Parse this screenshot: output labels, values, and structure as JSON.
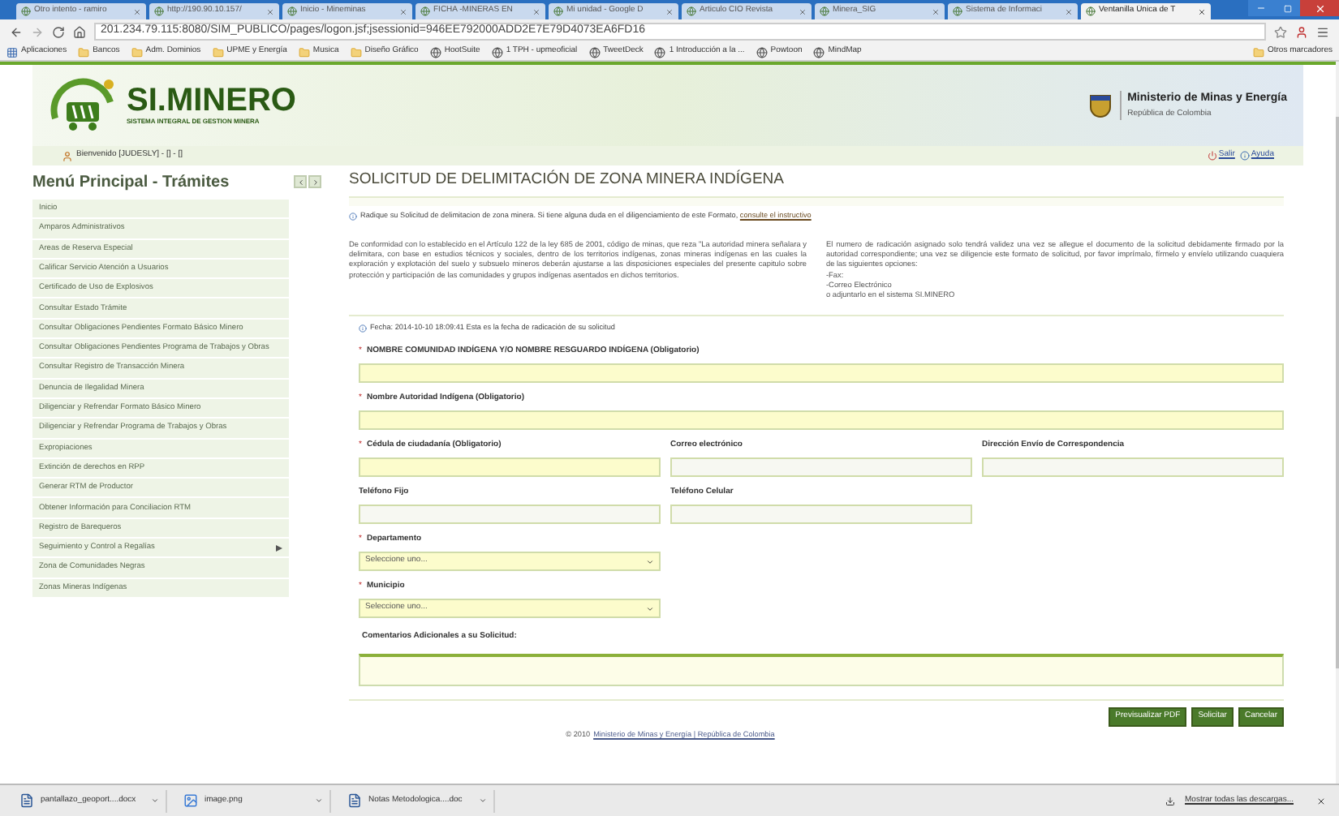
{
  "browser": {
    "tabs": [
      {
        "label": "Otro intento - ramiro",
        "selected": false
      },
      {
        "label": "http://190.90.10.157/",
        "selected": false
      },
      {
        "label": "Inicio - Mineminas",
        "selected": false
      },
      {
        "label": "FICHA -MINERAS EN",
        "selected": false
      },
      {
        "label": "Mi unidad - Google D",
        "selected": false
      },
      {
        "label": "Articulo CIO Revista",
        "selected": false
      },
      {
        "label": "Minera_SIG",
        "selected": false
      },
      {
        "label": "Sistema de Informaci",
        "selected": false
      },
      {
        "label": "Ventanilla Única de T",
        "selected": true
      }
    ],
    "address": "201.234.79.115:8080/SIM_PUBLICO/pages/logon.jsf;jsessionid=946EE792000ADD2E7E79D4073EA6FD16",
    "bookmarks": [
      {
        "label": "Aplicaciones",
        "kind": "apps"
      },
      {
        "label": "Bancos",
        "kind": "folder"
      },
      {
        "label": "Adm. Dominios",
        "kind": "folder"
      },
      {
        "label": "UPME y Energía",
        "kind": "folder"
      },
      {
        "label": "Musica",
        "kind": "folder"
      },
      {
        "label": "Diseño Gráfico",
        "kind": "folder"
      },
      {
        "label": "HootSuite",
        "kind": "site"
      },
      {
        "label": "1 TPH - upmeoficial",
        "kind": "site"
      },
      {
        "label": "TweetDeck",
        "kind": "site"
      },
      {
        "label": "1 Introducción a la ...",
        "kind": "site"
      },
      {
        "label": "Powtoon",
        "kind": "site"
      },
      {
        "label": "MindMap",
        "kind": "site"
      }
    ],
    "other_bookmarks": "Otros marcadores"
  },
  "header": {
    "logo_title": "SI.MINERO",
    "logo_subtitle": "SISTEMA INTEGRAL DE GESTION MINERA",
    "ministry": "Ministerio de Minas y Energía",
    "country": "República de Colombia"
  },
  "welcome": "Bienvenido [JUDESLY] - [] - []",
  "top_links": [
    "Salir",
    "Ayuda"
  ],
  "sidebar": {
    "title": "Menú Principal - Trámites",
    "items": [
      {
        "label": "Inicio",
        "has_submenu": false
      },
      {
        "label": "Amparos Administrativos",
        "has_submenu": false
      },
      {
        "label": "Areas de Reserva Especial",
        "has_submenu": false
      },
      {
        "label": "Calificar Servicio Atención a Usuarios",
        "has_submenu": false
      },
      {
        "label": "Certificado de Uso de Explosivos",
        "has_submenu": false
      },
      {
        "label": "Consultar Estado Trámite",
        "has_submenu": false
      },
      {
        "label": "Consultar Obligaciones Pendientes Formato Básico Minero",
        "has_submenu": false
      },
      {
        "label": "Consultar Obligaciones Pendientes Programa de Trabajos y Obras",
        "has_submenu": false
      },
      {
        "label": "Consultar Registro de Transacción Minera",
        "has_submenu": false
      },
      {
        "label": "Denuncia de Ilegalidad Minera",
        "has_submenu": false
      },
      {
        "label": "Diligenciar y Refrendar Formato Básico Minero",
        "has_submenu": false
      },
      {
        "label": "Diligenciar y Refrendar Programa de Trabajos y Obras",
        "has_submenu": false
      },
      {
        "label": "Expropiaciones",
        "has_submenu": false
      },
      {
        "label": "Extinción de derechos en RPP",
        "has_submenu": false
      },
      {
        "label": "Generar RTM de Productor",
        "has_submenu": false
      },
      {
        "label": "Obtener Información para Conciliacion RTM",
        "has_submenu": false
      },
      {
        "label": "Registro de Barequeros",
        "has_submenu": false
      },
      {
        "label": "Seguimiento y Control a Regalías",
        "has_submenu": true
      },
      {
        "label": "Zona de Comunidades Negras",
        "has_submenu": false
      },
      {
        "label": "Zonas Mineras Indígenas",
        "has_submenu": false
      }
    ]
  },
  "content": {
    "title": "SOLICITUD DE DELIMITACIÓN DE ZONA MINERA INDÍGENA",
    "notice": "Radique su Solicitud de delimitacion de zona minera. Si tiene alguna duda en el diligenciamiento de este Formato,",
    "notice_link": "consulte el instructivo",
    "paragraph_left": "De conformidad con lo establecido en el Artículo 122 de la ley 685 de 2001, código de minas, que reza \"La autoridad minera señalara y delimitara, con base en estudios técnicos y sociales, dentro de los territorios indígenas, zonas mineras indígenas en las cuales la exploración y explotación del suelo y subsuelo mineros deberán ajustarse a las disposiciones especiales del presente capitulo sobre protección y participación de las comunidades y grupos indígenas asentados en dichos territorios.",
    "paragraph_right": [
      "El numero de radicación asignado solo tendrá validez una vez se allegue el documento de la solicitud debidamente firmado por la autoridad correspondiente; una vez se diligencie este formato de solicitud, por favor imprímalo, fírmelo y envíelo utilizando cuaquiera de las siguientes opciones:",
      "-Fax:",
      "-Correo Electrónico",
      "o adjuntarlo en el sistema SI.MINERO"
    ],
    "date_notice": "Fecha: 2014-10-10 18:09:41 Esta es la fecha de radicación de su solicitud",
    "form_rows": [
      [
        {
          "marker": "*",
          "label": "NOMBRE COMUNIDAD INDÍGENA Y/O NOMBRE RESGUARDO INDÍGENA (Obligatorio)",
          "required": true,
          "kind": "text"
        }
      ],
      [
        {
          "marker": "*",
          "label": "Nombre Autoridad Indígena (Obligatorio)",
          "required": true,
          "kind": "text"
        }
      ],
      [
        {
          "marker": "*",
          "label": "Cédula de ciudadanía (Obligatorio)",
          "required": true,
          "kind": "text"
        },
        {
          "label": "Correo electrónico",
          "required": false,
          "kind": "text"
        },
        {
          "label": "Dirección Envío de Correspondencia",
          "required": false,
          "kind": "text"
        }
      ],
      [
        {
          "label": "Teléfono Fijo",
          "required": false,
          "kind": "text"
        },
        {
          "label": "Teléfono Celular",
          "required": false,
          "kind": "text"
        }
      ],
      [
        {
          "marker": "*",
          "label": "Departamento",
          "required": true,
          "kind": "select",
          "placeholder": "Seleccione uno..."
        }
      ],
      [
        {
          "marker": "*",
          "label": "Municipio",
          "required": true,
          "kind": "select",
          "placeholder": "Seleccione uno..."
        }
      ]
    ],
    "comments_label": "Comentarios Adicionales a su Solicitud:",
    "buttons": [
      "Previsualizar PDF",
      "Solicitar",
      "Cancelar"
    ]
  },
  "footer": {
    "copyright": "© 2010",
    "link": "Ministerio de Minas y Energía | República de Colombia"
  },
  "downloads": {
    "files": [
      {
        "name": "pantallazo_geoport....docx",
        "kind": "doc"
      },
      {
        "name": "image.png",
        "kind": "image"
      },
      {
        "name": "Notas Metodologica....doc",
        "kind": "doc"
      }
    ],
    "show_all": "Mostrar todas las descargas..."
  }
}
